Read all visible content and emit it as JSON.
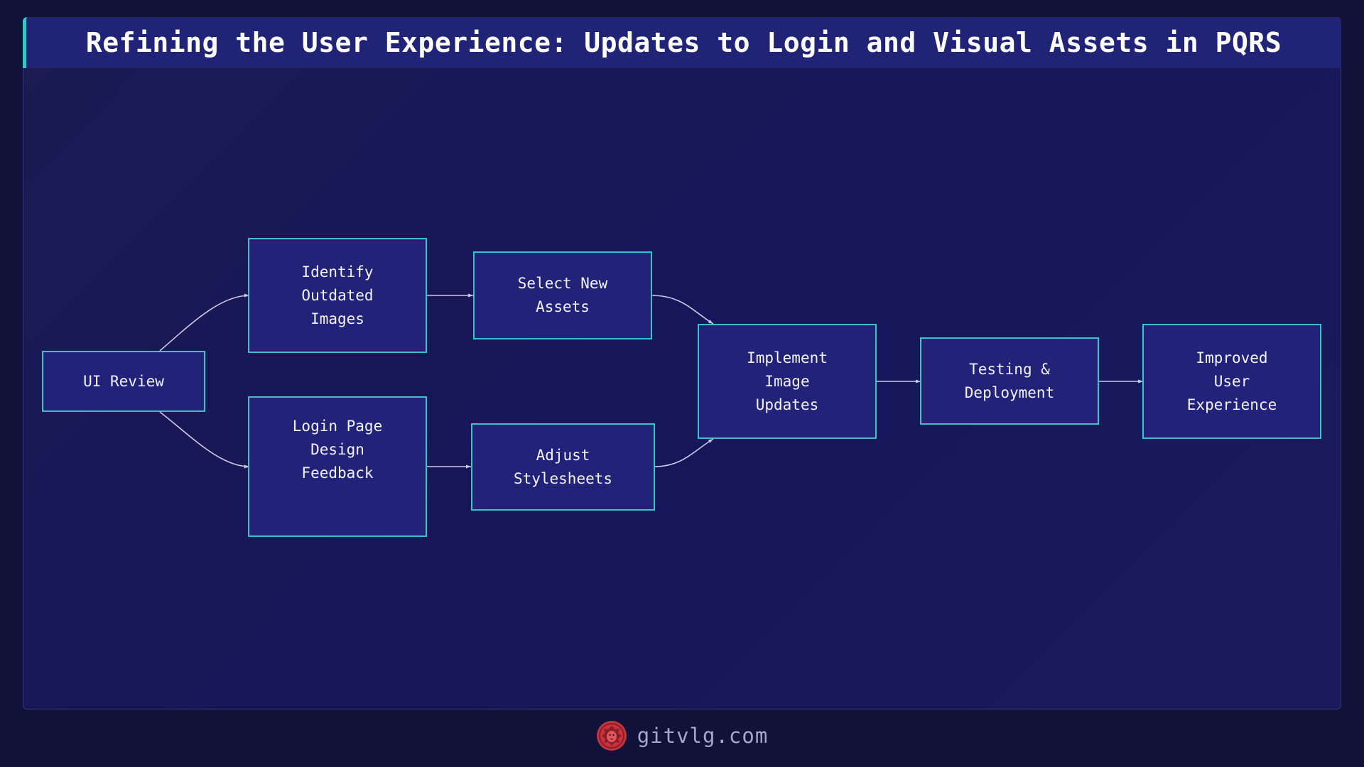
{
  "title": "Refining the User Experience: Updates to Login and Visual Assets in PQRS",
  "nodes": {
    "ui_review": "UI Review",
    "identify": "Identify\nOutdated\nImages",
    "login": "Login Page\nDesign\nFeedback",
    "select": "Select New\nAssets",
    "adjust": "Adjust\nStylesheets",
    "implement": "Implement\nImage\nUpdates",
    "testing": "Testing &\nDeployment",
    "improved": "Improved\nUser\nExperience"
  },
  "edges": [
    [
      "ui_review",
      "identify"
    ],
    [
      "ui_review",
      "login"
    ],
    [
      "identify",
      "select"
    ],
    [
      "login",
      "adjust"
    ],
    [
      "select",
      "implement"
    ],
    [
      "adjust",
      "implement"
    ],
    [
      "implement",
      "testing"
    ],
    [
      "testing",
      "improved"
    ]
  ],
  "footer": {
    "site": "gitvlg.com"
  },
  "colors": {
    "node_fill": "#222378",
    "node_border": "#3ec1c6",
    "edge": "#c9cbe6",
    "accent": "#36c7c9",
    "logo": "#c8323c"
  },
  "icons": {
    "logo": "lion-head-icon"
  }
}
